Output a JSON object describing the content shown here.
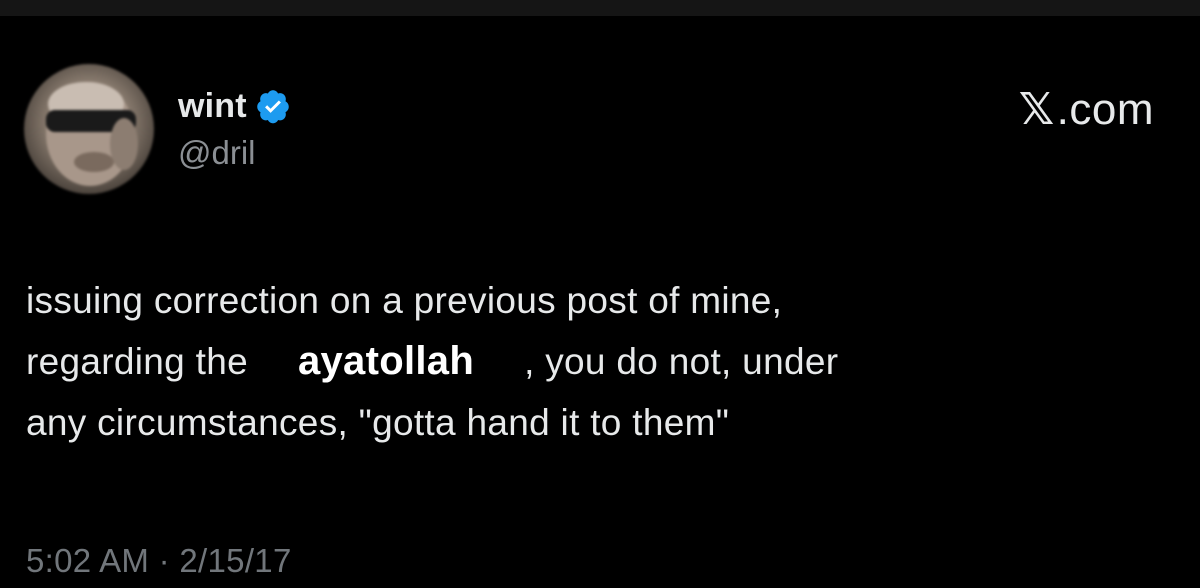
{
  "author": {
    "display_name": "wint",
    "handle": "@dril",
    "verified": true,
    "verified_color": "#1d9bf0",
    "avatar_icon": "blurred-face-avatar"
  },
  "brand": {
    "x_glyph": "𝕏",
    "domain_suffix": ".com"
  },
  "post": {
    "line1": "issuing correction on a previous post of mine,",
    "line2_before": "regarding the",
    "overlay_word": "ayatollah",
    "line2_after": ", you do not, under",
    "line3": "any circumstances, \"gotta hand it to them\""
  },
  "meta": {
    "timestamp": "5:02 AM · 2/15/17"
  },
  "colors": {
    "background": "#000000",
    "text_primary": "#e7e9ea",
    "text_secondary": "#71767b",
    "accent": "#1d9bf0"
  }
}
